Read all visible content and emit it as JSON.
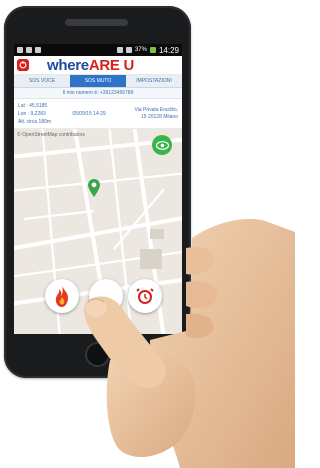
{
  "statusbar": {
    "time": "14:29",
    "battery": "37%"
  },
  "app": {
    "title_part1": "where",
    "title_part2": "ARE U"
  },
  "tabs": [
    {
      "label": "SOS VOCE",
      "active": false
    },
    {
      "label": "SOS MUTO",
      "active": true
    },
    {
      "label": "IMPOSTAZIONI",
      "active": false
    }
  ],
  "info": {
    "my_number": "Il mio numero è: +39123456789",
    "lat": "Lat : 45,5185",
    "lon": "Lon : 9,2283",
    "alt": "Alt. circa 180m",
    "datetime": "05/09/15 14:29",
    "address_line1": "Via Privata Eraclito,",
    "address_line2": "15 20128 Milano"
  },
  "map": {
    "credit": "© OpenStreetMap contributors",
    "pin_icon": "map-pin-icon",
    "view_icon": "eye-icon"
  },
  "actions": {
    "fire_icon": "fire-icon",
    "alert_icon": "alarm-icon"
  },
  "colors": {
    "brand_blue": "#1f4c9a",
    "brand_red": "#d9201c",
    "active_tab": "#2f73c8",
    "map_green": "#39b54a"
  }
}
